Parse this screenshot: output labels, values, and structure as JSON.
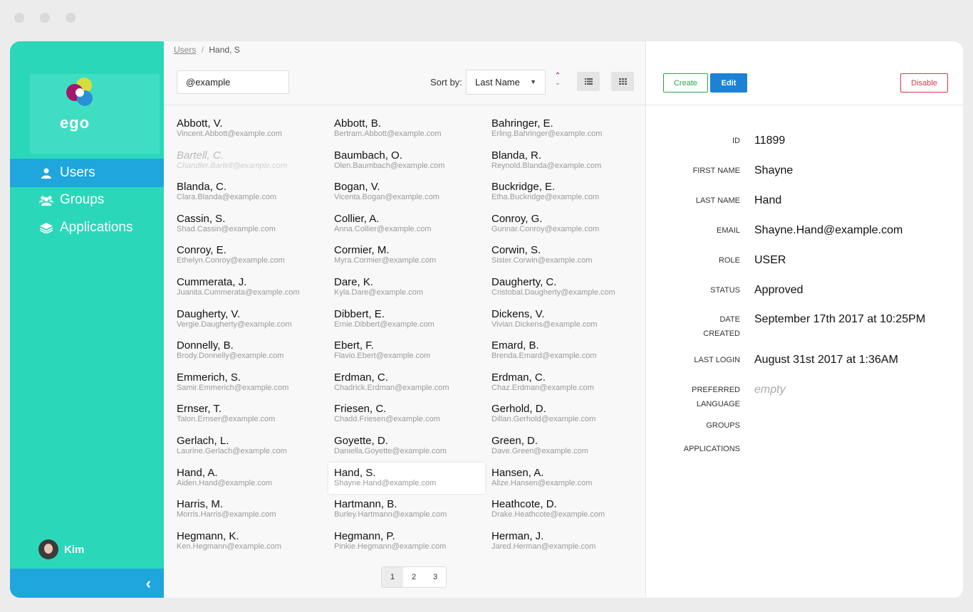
{
  "app": {
    "logo_text": "ego"
  },
  "breadcrumb": {
    "root": "Users",
    "separator": "/",
    "current": "Hand, S"
  },
  "nav": [
    {
      "label": "Users",
      "icon": "user-icon",
      "active": true
    },
    {
      "label": "Groups",
      "icon": "groups-icon",
      "active": false
    },
    {
      "label": "Applications",
      "icon": "layers-icon",
      "active": false
    }
  ],
  "current_user": {
    "name": "Kim"
  },
  "search": {
    "value": "@example"
  },
  "sort": {
    "label": "Sort by:",
    "value": "Last Name"
  },
  "users": [
    {
      "name": "Abbott, V.",
      "email": "Vincent.Abbott@example.com"
    },
    {
      "name": "Abbott, B.",
      "email": "Bertram.Abbott@example.com"
    },
    {
      "name": "Bahringer, E.",
      "email": "Erling.Bahringer@example.com"
    },
    {
      "name": "Bartell, C.",
      "email": "Chandler.Bartell@example.com",
      "disabled": true
    },
    {
      "name": "Baumbach, O.",
      "email": "Olen.Baumbach@example.com"
    },
    {
      "name": "Blanda, R.",
      "email": "Reynold.Blanda@example.com"
    },
    {
      "name": "Blanda, C.",
      "email": "Clara.Blanda@example.com"
    },
    {
      "name": "Bogan, V.",
      "email": "Vicenta.Bogan@example.com"
    },
    {
      "name": "Buckridge, E.",
      "email": "Etha.Buckridge@example.com"
    },
    {
      "name": "Cassin, S.",
      "email": "Shad.Cassin@example.com"
    },
    {
      "name": "Collier, A.",
      "email": "Anna.Collier@example.com"
    },
    {
      "name": "Conroy, G.",
      "email": "Gunnar.Conroy@example.com"
    },
    {
      "name": "Conroy, E.",
      "email": "Ethelyn.Conroy@example.com"
    },
    {
      "name": "Cormier, M.",
      "email": "Myra.Cormier@example.com"
    },
    {
      "name": "Corwin, S.",
      "email": "Sister.Corwin@example.com"
    },
    {
      "name": "Cummerata, J.",
      "email": "Juanita.Cummerata@example.com"
    },
    {
      "name": "Dare, K.",
      "email": "Kyla.Dare@example.com"
    },
    {
      "name": "Daugherty, C.",
      "email": "Cristobal.Daugherty@example.com"
    },
    {
      "name": "Daugherty, V.",
      "email": "Vergie.Daugherty@example.com"
    },
    {
      "name": "Dibbert, E.",
      "email": "Ernie.Dibbert@example.com"
    },
    {
      "name": "Dickens, V.",
      "email": "Vivian.Dickens@example.com"
    },
    {
      "name": "Donnelly, B.",
      "email": "Brody.Donnelly@example.com"
    },
    {
      "name": "Ebert, F.",
      "email": "Flavio.Ebert@example.com"
    },
    {
      "name": "Emard, B.",
      "email": "Brenda.Emard@example.com"
    },
    {
      "name": "Emmerich, S.",
      "email": "Samir.Emmerich@example.com"
    },
    {
      "name": "Erdman, C.",
      "email": "Chadrick.Erdman@example.com"
    },
    {
      "name": "Erdman, C.",
      "email": "Chaz.Erdman@example.com"
    },
    {
      "name": "Ernser, T.",
      "email": "Talon.Ernser@example.com"
    },
    {
      "name": "Friesen, C.",
      "email": "Chadd.Friesen@example.com"
    },
    {
      "name": "Gerhold, D.",
      "email": "Dillan.Gerhold@example.com"
    },
    {
      "name": "Gerlach, L.",
      "email": "Laurine.Gerlach@example.com"
    },
    {
      "name": "Goyette, D.",
      "email": "Daniella.Goyette@example.com"
    },
    {
      "name": "Green, D.",
      "email": "Dave.Green@example.com"
    },
    {
      "name": "Hand, A.",
      "email": "Aiden.Hand@example.com"
    },
    {
      "name": "Hand, S.",
      "email": "Shayne.Hand@example.com",
      "selected": true
    },
    {
      "name": "Hansen, A.",
      "email": "Alize.Hansen@example.com"
    },
    {
      "name": "Harris, M.",
      "email": "Morris.Harris@example.com"
    },
    {
      "name": "Hartmann, B.",
      "email": "Burley.Hartmann@example.com"
    },
    {
      "name": "Heathcote, D.",
      "email": "Drake.Heathcote@example.com"
    },
    {
      "name": "Hegmann, K.",
      "email": "Ken.Hegmann@example.com"
    },
    {
      "name": "Hegmann, P.",
      "email": "Pinkie.Hegmann@example.com"
    },
    {
      "name": "Herman, J.",
      "email": "Jared.Herman@example.com"
    }
  ],
  "pagination": {
    "pages": [
      "1",
      "2",
      "3"
    ],
    "current": "1"
  },
  "actions": {
    "create": "Create",
    "edit": "Edit",
    "disable": "Disable"
  },
  "details": {
    "id_label": "ID",
    "id": "11899",
    "first_name_label": "FIRST NAME",
    "first_name": "Shayne",
    "last_name_label": "LAST NAME",
    "last_name": "Hand",
    "email_label": "EMAIL",
    "email": "Shayne.Hand@example.com",
    "role_label": "ROLE",
    "role": "USER",
    "status_label": "STATUS",
    "status": "Approved",
    "date_created_label": "DATE CREATED",
    "date_created": "September 17th 2017 at 10:25PM",
    "last_login_label": "LAST LOGIN",
    "last_login": "August 31st 2017 at 1:36AM",
    "preferred_language_label": "PREFERRED LANGUAGE",
    "preferred_language": "empty",
    "groups_label": "GROUPS",
    "applications_label": "APPLICATIONS"
  },
  "colors": {
    "sidebar": "#2ad8b9",
    "active_nav": "#1fa6dc",
    "edit_button": "#1c82d6",
    "create_button": "#28a745",
    "disable_button": "#dc3545"
  }
}
